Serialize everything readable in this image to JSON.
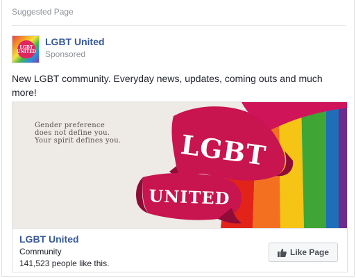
{
  "header": {
    "suggested_label": "Suggested Page"
  },
  "page": {
    "name": "LGBT United",
    "sponsored_label": "Sponsored",
    "avatar_text": "LGBT UNITED"
  },
  "post": {
    "text": "New LGBT community. Everyday news, updates, coming outs and much more!"
  },
  "ad": {
    "tagline": "Gender preference\ndoes not define you.\nYour spirit defines you.",
    "banner_word_1": "LGBT",
    "banner_word_2": "UNITED"
  },
  "footer": {
    "page_name": "LGBT United",
    "category": "Community",
    "likes": "141,523 people like this.",
    "like_button_label": "Like Page",
    "like_icon": "thumbs-up-icon"
  },
  "colors": {
    "link_blue": "#365899",
    "banner_pink": "#c8144f",
    "meta_gray": "#90949c"
  }
}
